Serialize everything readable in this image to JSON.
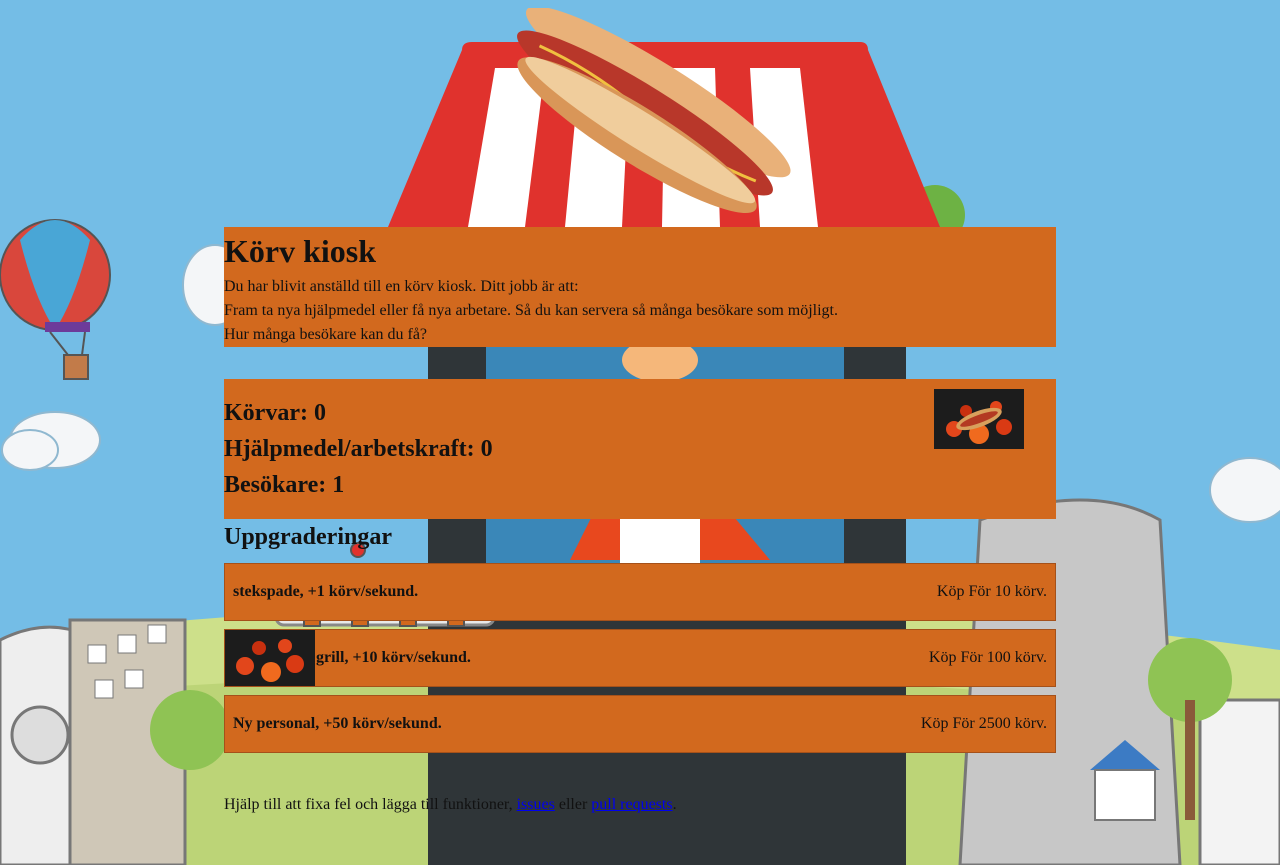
{
  "intro": {
    "title": "Körv kiosk",
    "line1": "Du har blivit anställd till en körv kiosk. Ditt jobb är att:",
    "line2": "Fram ta nya hjälpmedel eller få nya arbetare. Så du kan servera så många besökare som möjligt.",
    "line3": "Hur många besökare kan du få?"
  },
  "stats": {
    "korvar": "Körvar: 0",
    "hjalpmedel": "Hjälpmedel/arbetskraft: 0",
    "besokare": "Besökare: 1"
  },
  "upgrades": {
    "title": "Uppgraderingar",
    "items": [
      {
        "name": "stekspade, +1 körv/sekund.",
        "price": "Köp För 10 körv."
      },
      {
        "name": "grill, +10 körv/sekund.",
        "price": "Köp För 100 körv."
      },
      {
        "name": "Ny personal, +50 körv/sekund.",
        "price": "Köp För 2500 körv."
      }
    ]
  },
  "footer": {
    "text_before": "Hjälp till att fixa fel och lägga till funktioner,",
    "link_issues": "issues",
    "text_middle": "eller",
    "link_pulls": "pull requests",
    "text_after": "."
  },
  "colors": {
    "sky": "#74bde6",
    "panel": "#d2691e",
    "awning_red": "#e0322d",
    "kiosk_dark": "#2f3538",
    "grass": "#cde08a",
    "link": "#0000ee"
  },
  "icons": {
    "hotdog": "hotdog-icon",
    "grill": "grill-icon",
    "spatula": "spatula-icon"
  }
}
